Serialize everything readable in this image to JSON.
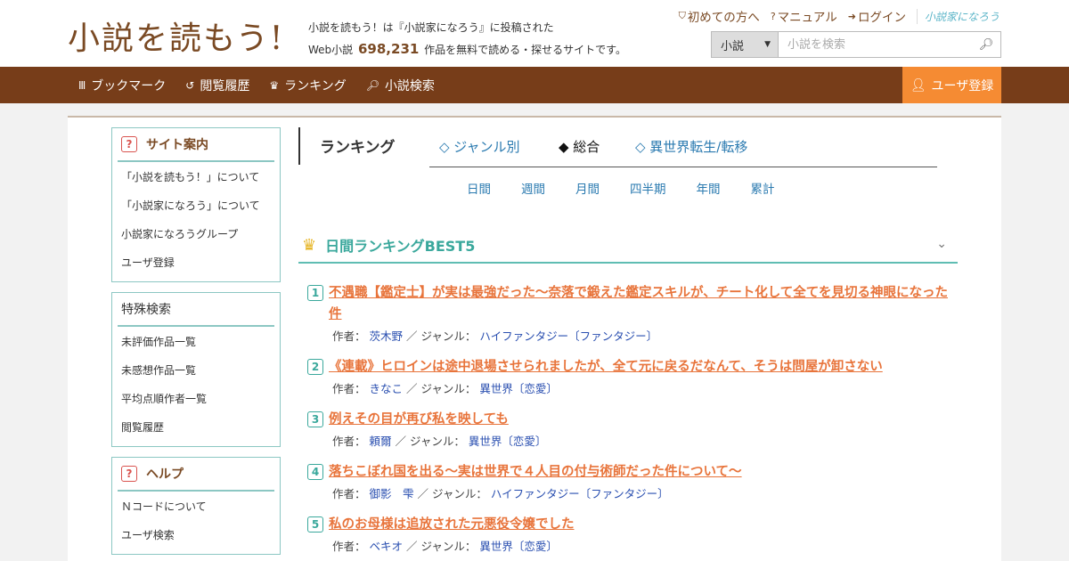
{
  "header": {
    "logo": "小説を読もう!",
    "tagline_line1": "小説を読もう！は『小説家になろう』に投稿された",
    "tagline_prefix": "Web小説",
    "work_count": "698,231",
    "tagline_suffix": "作品を無料で読める・探せるサイトです。",
    "links": [
      {
        "icon": "⛉",
        "label": "初めての方へ"
      },
      {
        "icon": "?",
        "label": "マニュアル"
      },
      {
        "icon": "➜",
        "label": "ログイン"
      }
    ],
    "brand": "小説家になろう",
    "search": {
      "select_value": "小説",
      "placeholder": "小説を検索"
    }
  },
  "nav": {
    "items": [
      {
        "icon": "Ⅲ",
        "label": "ブックマーク"
      },
      {
        "icon": "↺",
        "label": "閲覧履歴"
      },
      {
        "icon": "♛",
        "label": "ランキング"
      },
      {
        "icon": "🔍",
        "label": "小説検索"
      }
    ],
    "register": "ユーザ登録"
  },
  "sidebar": {
    "site_info": {
      "title": "サイト案内",
      "items": [
        "「小説を読もう！」について",
        "「小説家になろう」について",
        "小説家になろうグループ",
        "ユーザ登録"
      ]
    },
    "special": {
      "title": "特殊検索",
      "items": [
        "未評価作品一覧",
        "未感想作品一覧",
        "平均点順作者一覧",
        "閲覧履歴"
      ]
    },
    "help": {
      "title": "ヘルプ",
      "items": [
        "Ｎコードについて",
        "ユーザ検索"
      ]
    }
  },
  "ranking": {
    "heading": "ランキング",
    "tabs": [
      "◇ ジャンル別",
      "◆ 総合",
      "◇ 異世界転生/転移"
    ],
    "periods": [
      "日間",
      "週間",
      "月間",
      "四半期",
      "年間",
      "累計"
    ],
    "best_title": "日間ランキングBEST5",
    "author_label": "作者：",
    "genre_label": "／ ジャンル：",
    "items": [
      {
        "rank": "1",
        "title": "不遇職【鑑定士】が実は最強だった〜奈落で鍛えた鑑定スキルが、チート化して全てを見切る神眼になった件",
        "author": "茨木野",
        "genre": "ハイファンタジー〔ファンタジー〕"
      },
      {
        "rank": "2",
        "title": "《連載》ヒロインは途中退場させられましたが、全て元に戻るだなんて、そうは問屋が卸さない",
        "author": "きなこ",
        "genre": "異世界〔恋愛〕"
      },
      {
        "rank": "3",
        "title": "例えその目が再び私を映しても",
        "author": "頼爾",
        "genre": "異世界〔恋愛〕"
      },
      {
        "rank": "4",
        "title": "落ちこぼれ国を出る〜実は世界で４人目の付与術師だった件について〜",
        "author": "御影　雫",
        "genre": "ハイファンタジー〔ファンタジー〕"
      },
      {
        "rank": "5",
        "title": "私のお母様は追放された元悪役令嬢でした",
        "author": "ベキオ",
        "genre": "異世界〔恋愛〕"
      }
    ]
  }
}
